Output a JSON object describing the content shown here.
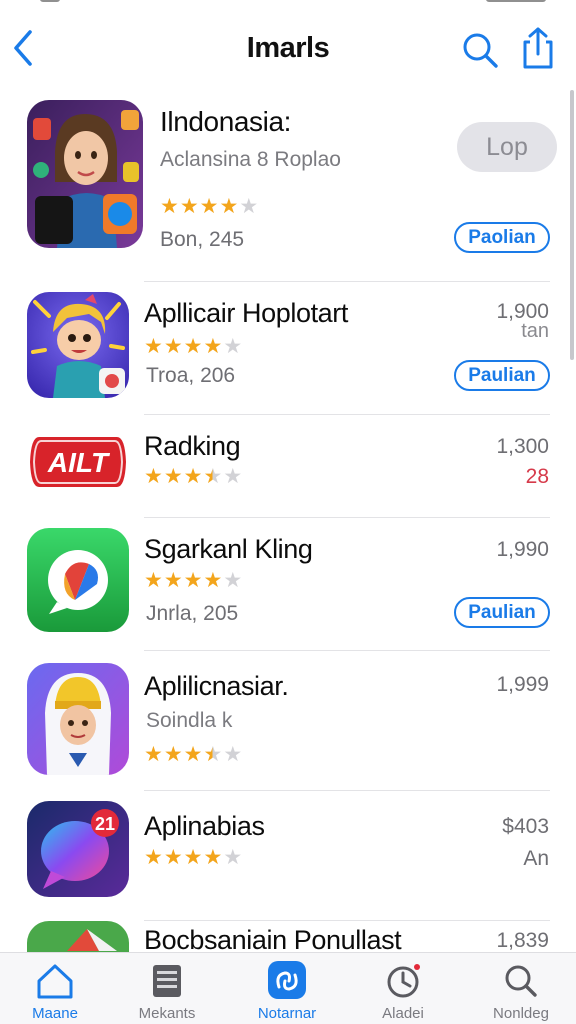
{
  "nav": {
    "title": "Imarls",
    "back_icon": "chevron-left-icon",
    "search_icon": "search-icon",
    "share_icon": "share-icon"
  },
  "colors": {
    "accent": "#1a7be8",
    "star": "#f3a51c",
    "rank": "#d63a4a"
  },
  "apps": [
    {
      "name": "Ilndonasia:",
      "subtitle": "Aclansina 8 Roplao",
      "rating": 4,
      "meta": "Bon, 245",
      "button": "Lop",
      "action": "Paolian",
      "icon": "avatar-app-icon"
    },
    {
      "name": "Apllicair Hoplotart",
      "rating": 4,
      "meta": "Troa, 206",
      "price": "1,900",
      "price_sub": "tan",
      "action": "Paulian",
      "icon": "cartoon-app-icon"
    },
    {
      "name": "Radking",
      "rating": 3.5,
      "price": "1,300",
      "rank": "28",
      "icon": "ailt-logo-icon",
      "logo_text": "AILT"
    },
    {
      "name": "Sgarkanl Kling",
      "rating": 4,
      "meta": "Jnrla, 205",
      "price": "1,990",
      "action": "Paulian",
      "icon": "green-chat-icon"
    },
    {
      "name": "Aplilicnasiar.",
      "subtitle": "Soindla k",
      "rating": 3.5,
      "price": "1,999",
      "icon": "hooded-avatar-icon"
    },
    {
      "name": "Aplinabias",
      "rating": 4,
      "price": "$403",
      "price_sub": "An",
      "icon": "messenger-icon",
      "badge": "21"
    },
    {
      "name": "Bocbsaniain Ponullast",
      "price": "1,839",
      "icon": "partial-app-icon"
    }
  ],
  "tabs": [
    {
      "label": "Maane",
      "icon": "home-icon",
      "active": true
    },
    {
      "label": "Mekants",
      "icon": "calendar-icon",
      "active": false
    },
    {
      "label": "Notarnar",
      "icon": "app-link-icon",
      "active": true
    },
    {
      "label": "Aladei",
      "icon": "clock-icon",
      "active": false
    },
    {
      "label": "Nonldeg",
      "icon": "search-icon",
      "active": false
    }
  ]
}
